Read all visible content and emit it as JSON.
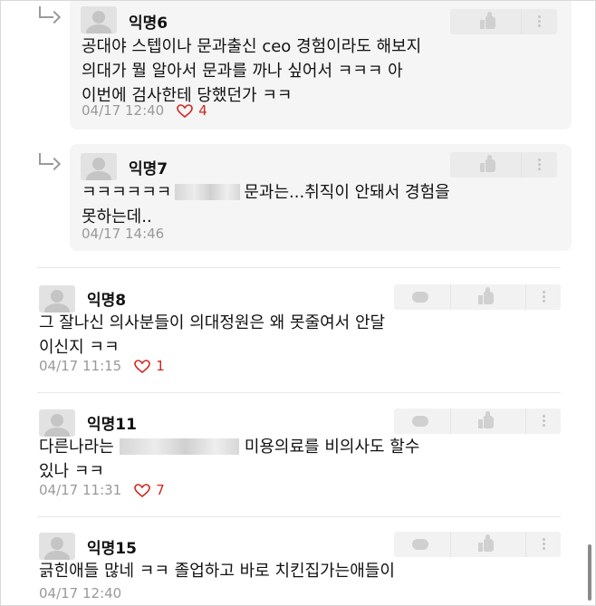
{
  "comments": [
    {
      "author": "익명6",
      "line1": "공대야 스텝이나 문과출신 ceo 경험이라도 해보지",
      "line2": "의대가 뭘 알아서 문과를 까나 싶어서 ㅋㅋㅋ 아",
      "line3": "이번에 검사한테 당했던가 ㅋㅋ",
      "time": "04/17 12:40",
      "likes": "4",
      "is_reply": true
    },
    {
      "author": "익명7",
      "line1a": "ㅋㅋㅋㅋㅋㅋ",
      "line1b": "문과는...취직이 안돼서 경험을",
      "line2": "못하는데..",
      "time": "04/17 14:46",
      "likes": "",
      "is_reply": true
    },
    {
      "author": "익명8",
      "line1": "그 잘나신 의사분들이 의대정원은 왜 못줄여서 안달",
      "line2": "이신지 ㅋㅋ",
      "time": "04/17 11:15",
      "likes": "1",
      "is_reply": false
    },
    {
      "author": "익명11",
      "line1a": "다른나라는",
      "line1b": "미용의료를 비의사도 할수",
      "line2": "있나 ㅋㅋ",
      "time": "04/17 11:31",
      "likes": "7",
      "is_reply": false
    },
    {
      "author": "익명15",
      "line1": "긁힌애들 많네 ㅋㅋ 졸업하고 바로 치킨집가는애들이",
      "time": "04/17 12:40",
      "likes": "",
      "is_reply": false
    }
  ],
  "icons": {
    "reply": "reply-arrow-icon",
    "comment": "comment-bubble-icon",
    "vote": "thumbs-up-icon",
    "more": "more-vertical-icon",
    "like": "heart-icon"
  },
  "colors": {
    "like": "#d0241c",
    "meta": "#999999",
    "reply_bg": "#f5f5f5"
  }
}
